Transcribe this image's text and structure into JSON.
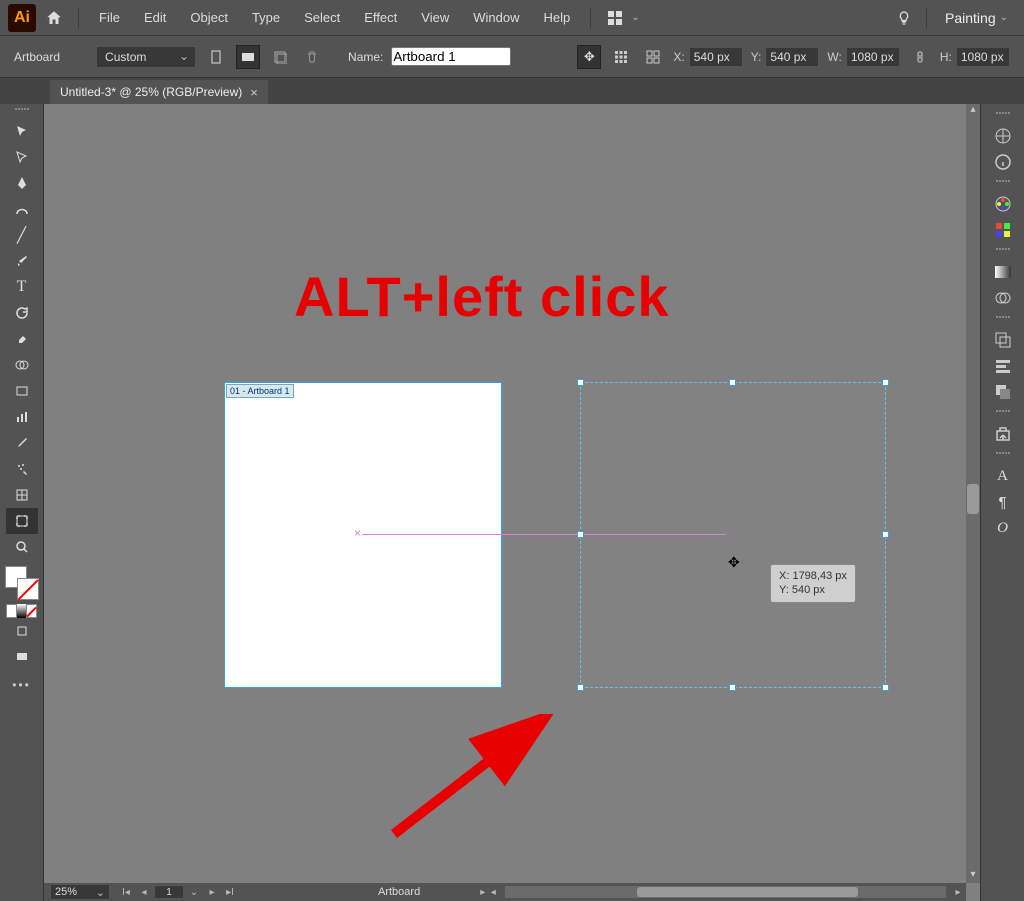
{
  "menubar": {
    "logo": "Ai",
    "items": [
      "File",
      "Edit",
      "Object",
      "Type",
      "Select",
      "Effect",
      "View",
      "Window",
      "Help"
    ],
    "workspace": "Painting"
  },
  "controlbar": {
    "tool_label": "Artboard",
    "preset": "Custom",
    "name_label": "Name:",
    "name_value": "Artboard 1",
    "x_label": "X:",
    "x_value": "540 px",
    "y_label": "Y:",
    "y_value": "540 px",
    "w_label": "W:",
    "w_value": "1080 px",
    "h_label": "H:",
    "h_value": "1080 px"
  },
  "tab": {
    "title": "Untitled-3* @ 25% (RGB/Preview)"
  },
  "artboard": {
    "label": "01 - Artboard 1"
  },
  "tooltip": {
    "x": "X: 1798,43 px",
    "y": "Y: 540 px"
  },
  "annotation": "ALT+left click",
  "statusbar": {
    "zoom": "25%",
    "artboard_index": "1",
    "artboard_label": "Artboard"
  }
}
